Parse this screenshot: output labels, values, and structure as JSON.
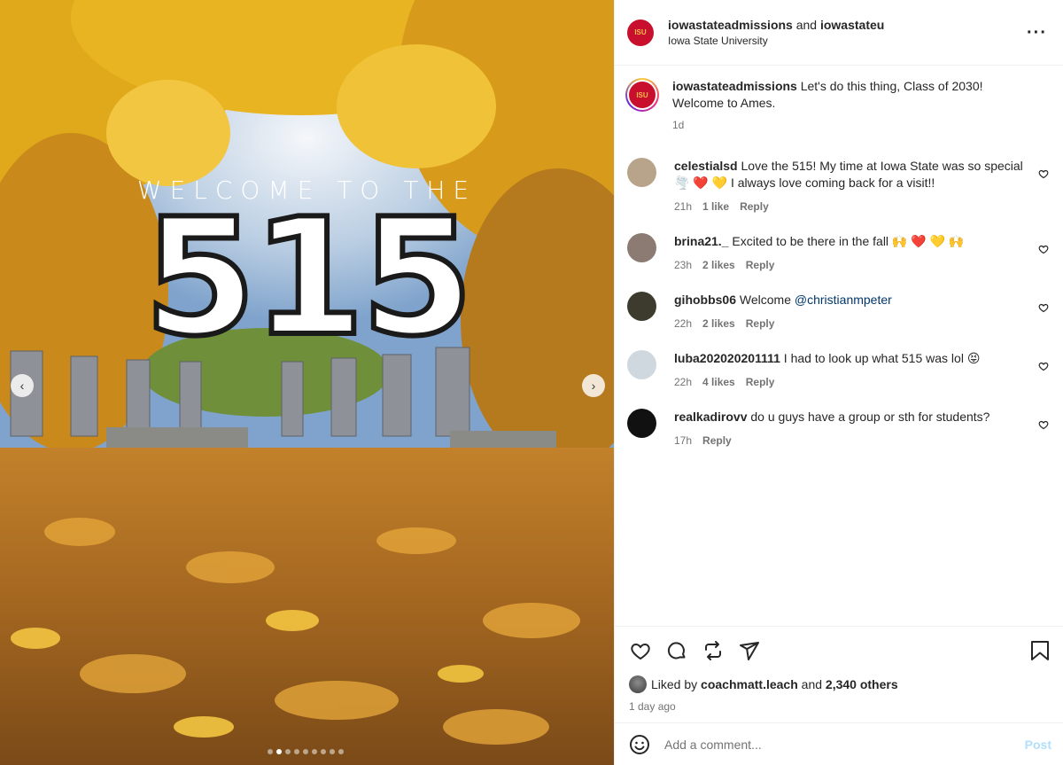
{
  "post": {
    "hero_small": "WELCOME TO THE",
    "hero_big": "515",
    "carousel_dots": 9,
    "active_dot": 1
  },
  "header": {
    "user1": "iowastateadmissions",
    "joiner": "and",
    "user2": "iowastateu",
    "subtitle": "Iowa State University",
    "more_icon": "more-horizontal-icon"
  },
  "caption": {
    "user": "iowastateadmissions",
    "text": "Let's do this thing, Class of 2030! Welcome to Ames.",
    "time": "1d"
  },
  "comments": [
    {
      "user": "celestialsd",
      "text": "Love the 515! My time at Iowa State was so special 🌪️ ❤️ 💛 I always love coming back for a visit!!",
      "time": "21h",
      "likes": "1 like",
      "reply": "Reply",
      "avatar_color": "#b7a48a"
    },
    {
      "user": "brina21._",
      "text": "Excited to be there in the fall 🙌 ❤️ 💛 🙌",
      "time": "23h",
      "likes": "2 likes",
      "reply": "Reply",
      "avatar_color": "#8b7b72"
    },
    {
      "user": "gihobbs06",
      "text": "Welcome ",
      "mention": "@christianmpeter",
      "time": "22h",
      "likes": "2 likes",
      "reply": "Reply",
      "avatar_color": "#3d3a2e"
    },
    {
      "user": "luba202020201111",
      "text": "I had to look up what 515 was lol 😝",
      "time": "22h",
      "likes": "4 likes",
      "reply": "Reply",
      "avatar_color": "#cfd7df"
    },
    {
      "user": "realkadirovv",
      "text": "do u guys have a group or sth for students?",
      "time": "17h",
      "likes": "",
      "reply": "Reply",
      "avatar_color": "#111111"
    }
  ],
  "actions": {
    "liked_prefix": "Liked by",
    "liked_user": "coachmatt.leach",
    "liked_and": "and",
    "liked_others": "2,340 others",
    "ago": "1 day ago"
  },
  "composer": {
    "placeholder": "Add a comment...",
    "post_label": "Post"
  }
}
